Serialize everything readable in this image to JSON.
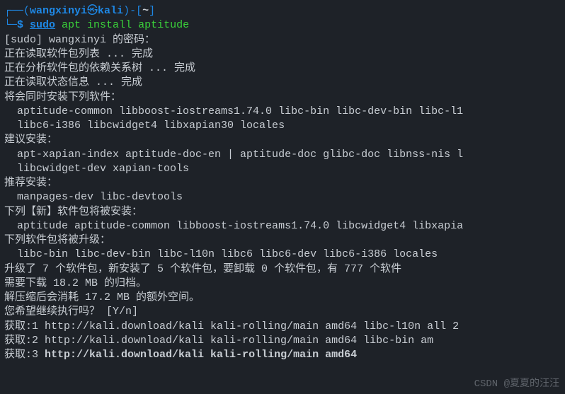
{
  "prompt": {
    "user": "wangxinyi",
    "host": "kali",
    "path": "~",
    "sudo": "sudo",
    "cmd_rest": " apt install aptitude"
  },
  "lines": {
    "sudo_pwd": "[sudo] wangxinyi 的密码：",
    "read_pkg": "正在读取软件包列表 ... 完成",
    "dep_tree": "正在分析软件包的依赖关系树 ... 完成",
    "state": "正在读取状态信息 ... 完成",
    "also_install_hdr": "将会同时安装下列软件：",
    "also_1": "  aptitude-common libboost-iostreams1.74.0 libc-bin libc-dev-bin libc-l1",
    "also_2": "  libc6-i386 libcwidget4 libxapian30 locales",
    "suggest_hdr": "建议安装：",
    "suggest_1": "  apt-xapian-index aptitude-doc-en | aptitude-doc glibc-doc libnss-nis l",
    "suggest_2": "  libcwidget-dev xapian-tools",
    "recommend_hdr": "推荐安装：",
    "recommend_1": "  manpages-dev libc-devtools",
    "new_hdr": "下列【新】软件包将被安装：",
    "new_1": "  aptitude aptitude-common libboost-iostreams1.74.0 libcwidget4 libxapia",
    "upgrade_hdr": "下列软件包将被升级：",
    "upgrade_1": "  libc-bin libc-dev-bin libc-l10n libc6 libc6-dev libc6-i386 locales",
    "summary_1": "升级了 7 个软件包，新安装了 5 个软件包，要卸载 0 个软件包，有 777 个软件",
    "summary_2": "需要下载 18.2 MB 的归档。",
    "summary_3": "解压缩后会消耗 17.2 MB 的额外空间。",
    "confirm": "您希望继续执行吗？ [Y/n]",
    "fetch_1": "获取:1 http://kali.download/kali kali-rolling/main amd64 libc-l10n all 2",
    "fetch_2": "获取:2 http://kali.download/kali kali-rolling/main amd64 libc-bin am",
    "fetch_3_a": "获取:3 ",
    "fetch_3_b": "http://kali.download/kali kali-rolling/main amd64   "
  },
  "watermark": "CSDN @夏夏的汪汪"
}
